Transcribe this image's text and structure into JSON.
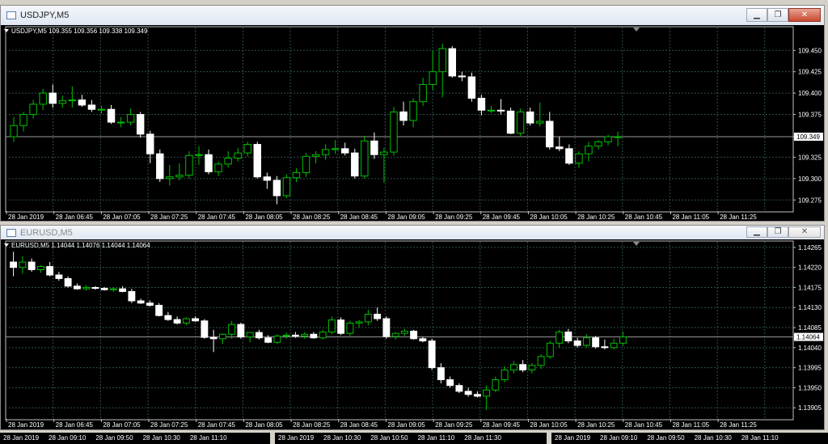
{
  "colors": {
    "bull": "#00c000",
    "bear": "#ffffff",
    "bg": "#000000",
    "grid": "#2f4f4f",
    "text": "#ffffff"
  },
  "window1": {
    "title": "USDJPY,M5",
    "header_text": "USDJPY,M5  109.355 109.356 109.338 109.349",
    "price_label": "109.349",
    "y_ticks": [
      "109.450",
      "109.425",
      "109.400",
      "109.375",
      "109.349",
      "109.325",
      "109.300",
      "109.275"
    ],
    "x_labels": [
      "28 Jan 2019",
      "28 Jan 06:45",
      "28 Jan 07:05",
      "28 Jan 07:25",
      "28 Jan 07:45",
      "28 Jan 08:05",
      "28 Jan 08:25",
      "28 Jan 08:45",
      "28 Jan 09:05",
      "28 Jan 09:25",
      "28 Jan 09:45",
      "28 Jan 10:05",
      "28 Jan 10:25",
      "28 Jan 10:45",
      "28 Jan 11:05",
      "28 Jan 11:25"
    ],
    "buttons": {
      "minimize": "▁",
      "restore": "❐",
      "close": "✕"
    }
  },
  "window2": {
    "title": "EURUSD,M5",
    "header_text": "EURUSD,M5  1.14044 1.14076 1.14044 1.14064",
    "price_label": "1.14064",
    "y_ticks": [
      "1.14265",
      "1.14220",
      "1.14175",
      "1.14130",
      "1.14085",
      "1.14040",
      "1.13995",
      "1.13950",
      "1.13905"
    ],
    "x_labels": [
      "28 Jan 2019",
      "28 Jan 06:45",
      "28 Jan 07:05",
      "28 Jan 07:25",
      "28 Jan 07:45",
      "28 Jan 08:05",
      "28 Jan 08:25",
      "28 Jan 08:45",
      "28 Jan 09:05",
      "28 Jan 09:25",
      "28 Jan 09:45",
      "28 Jan 10:05",
      "28 Jan 10:25",
      "28 Jan 10:45",
      "28 Jan 11:05",
      "28 Jan 11:25"
    ],
    "buttons": {
      "minimize": "▁",
      "restore": "❐",
      "close": "✕"
    }
  },
  "bottom_tabs": [
    {
      "labels": [
        "28 Jan 2019",
        "28 Jan 09:10",
        "28 Jan 09:50",
        "28 Jan 10:30",
        "28 Jan 11:10"
      ]
    },
    {
      "labels": [
        "28 Jan 2019",
        "28 Jan 10:30",
        "28 Jan 10:50",
        "28 Jan 11:10",
        "28 Jan 11:30"
      ]
    },
    {
      "labels": [
        "28 Jan 2019",
        "28 Jan 09:10",
        "28 Jan 09:50",
        "28 Jan 10:30",
        "28 Jan 11:10"
      ]
    }
  ],
  "chart_data": [
    {
      "type": "candlestick",
      "title": "USDJPY,M5",
      "ylim": [
        109.262,
        109.472
      ],
      "candles": [
        {
          "o": 109.349,
          "h": 109.372,
          "l": 109.343,
          "c": 109.362
        },
        {
          "o": 109.362,
          "h": 109.378,
          "l": 109.355,
          "c": 109.375
        },
        {
          "o": 109.375,
          "h": 109.392,
          "l": 109.37,
          "c": 109.387
        },
        {
          "o": 109.387,
          "h": 109.405,
          "l": 109.38,
          "c": 109.4
        },
        {
          "o": 109.4,
          "h": 109.41,
          "l": 109.383,
          "c": 109.388
        },
        {
          "o": 109.388,
          "h": 109.397,
          "l": 109.383,
          "c": 109.391
        },
        {
          "o": 109.391,
          "h": 109.408,
          "l": 109.383,
          "c": 109.392
        },
        {
          "o": 109.392,
          "h": 109.398,
          "l": 109.384,
          "c": 109.386
        },
        {
          "o": 109.386,
          "h": 109.392,
          "l": 109.378,
          "c": 109.381
        },
        {
          "o": 109.381,
          "h": 109.385,
          "l": 109.376,
          "c": 109.381
        },
        {
          "o": 109.381,
          "h": 109.386,
          "l": 109.364,
          "c": 109.366
        },
        {
          "o": 109.366,
          "h": 109.372,
          "l": 109.36,
          "c": 109.366
        },
        {
          "o": 109.366,
          "h": 109.382,
          "l": 109.362,
          "c": 109.375
        },
        {
          "o": 109.375,
          "h": 109.378,
          "l": 109.348,
          "c": 109.352
        },
        {
          "o": 109.352,
          "h": 109.356,
          "l": 109.318,
          "c": 109.329
        },
        {
          "o": 109.329,
          "h": 109.334,
          "l": 109.296,
          "c": 109.3
        },
        {
          "o": 109.3,
          "h": 109.316,
          "l": 109.292,
          "c": 109.302
        },
        {
          "o": 109.302,
          "h": 109.318,
          "l": 109.298,
          "c": 109.304
        },
        {
          "o": 109.304,
          "h": 109.332,
          "l": 109.3,
          "c": 109.327
        },
        {
          "o": 109.327,
          "h": 109.338,
          "l": 109.316,
          "c": 109.328
        },
        {
          "o": 109.328,
          "h": 109.334,
          "l": 109.305,
          "c": 109.308
        },
        {
          "o": 109.308,
          "h": 109.32,
          "l": 109.303,
          "c": 109.317
        },
        {
          "o": 109.317,
          "h": 109.332,
          "l": 109.313,
          "c": 109.324
        },
        {
          "o": 109.324,
          "h": 109.336,
          "l": 109.32,
          "c": 109.33
        },
        {
          "o": 109.33,
          "h": 109.343,
          "l": 109.326,
          "c": 109.34
        },
        {
          "o": 109.34,
          "h": 109.343,
          "l": 109.3,
          "c": 109.302
        },
        {
          "o": 109.302,
          "h": 109.307,
          "l": 109.288,
          "c": 109.298
        },
        {
          "o": 109.298,
          "h": 109.303,
          "l": 109.27,
          "c": 109.28
        },
        {
          "o": 109.28,
          "h": 109.305,
          "l": 109.277,
          "c": 109.301
        },
        {
          "o": 109.301,
          "h": 109.312,
          "l": 109.296,
          "c": 109.307
        },
        {
          "o": 109.307,
          "h": 109.33,
          "l": 109.302,
          "c": 109.326
        },
        {
          "o": 109.326,
          "h": 109.332,
          "l": 109.318,
          "c": 109.328
        },
        {
          "o": 109.328,
          "h": 109.34,
          "l": 109.322,
          "c": 109.334
        },
        {
          "o": 109.334,
          "h": 109.345,
          "l": 109.329,
          "c": 109.335
        },
        {
          "o": 109.335,
          "h": 109.342,
          "l": 109.327,
          "c": 109.33
        },
        {
          "o": 109.33,
          "h": 109.335,
          "l": 109.3,
          "c": 109.303
        },
        {
          "o": 109.303,
          "h": 109.35,
          "l": 109.3,
          "c": 109.344
        },
        {
          "o": 109.344,
          "h": 109.354,
          "l": 109.323,
          "c": 109.328
        },
        {
          "o": 109.328,
          "h": 109.336,
          "l": 109.295,
          "c": 109.331
        },
        {
          "o": 109.331,
          "h": 109.384,
          "l": 109.327,
          "c": 109.378
        },
        {
          "o": 109.378,
          "h": 109.39,
          "l": 109.362,
          "c": 109.368
        },
        {
          "o": 109.368,
          "h": 109.394,
          "l": 109.36,
          "c": 109.39
        },
        {
          "o": 109.39,
          "h": 109.418,
          "l": 109.385,
          "c": 109.41
        },
        {
          "o": 109.41,
          "h": 109.45,
          "l": 109.403,
          "c": 109.425
        },
        {
          "o": 109.425,
          "h": 109.458,
          "l": 109.395,
          "c": 109.452
        },
        {
          "o": 109.452,
          "h": 109.455,
          "l": 109.418,
          "c": 109.42
        },
        {
          "o": 109.42,
          "h": 109.425,
          "l": 109.414,
          "c": 109.419
        },
        {
          "o": 109.419,
          "h": 109.424,
          "l": 109.39,
          "c": 109.394
        },
        {
          "o": 109.394,
          "h": 109.398,
          "l": 109.374,
          "c": 109.38
        },
        {
          "o": 109.38,
          "h": 109.385,
          "l": 109.377,
          "c": 109.38
        },
        {
          "o": 109.38,
          "h": 109.393,
          "l": 109.375,
          "c": 109.379
        },
        {
          "o": 109.379,
          "h": 109.383,
          "l": 109.352,
          "c": 109.353
        },
        {
          "o": 109.353,
          "h": 109.382,
          "l": 109.35,
          "c": 109.378
        },
        {
          "o": 109.378,
          "h": 109.383,
          "l": 109.362,
          "c": 109.365
        },
        {
          "o": 109.365,
          "h": 109.389,
          "l": 109.361,
          "c": 109.367
        },
        {
          "o": 109.367,
          "h": 109.378,
          "l": 109.334,
          "c": 109.337
        },
        {
          "o": 109.337,
          "h": 109.349,
          "l": 109.332,
          "c": 109.335
        },
        {
          "o": 109.335,
          "h": 109.34,
          "l": 109.316,
          "c": 109.318
        },
        {
          "o": 109.318,
          "h": 109.332,
          "l": 109.313,
          "c": 109.329
        },
        {
          "o": 109.329,
          "h": 109.343,
          "l": 109.32,
          "c": 109.338
        },
        {
          "o": 109.338,
          "h": 109.345,
          "l": 109.334,
          "c": 109.343
        },
        {
          "o": 109.343,
          "h": 109.351,
          "l": 109.339,
          "c": 109.349
        },
        {
          "o": 109.349,
          "h": 109.355,
          "l": 109.338,
          "c": 109.349
        }
      ]
    },
    {
      "type": "candlestick",
      "title": "EURUSD,M5",
      "ylim": [
        1.1388,
        1.14272
      ],
      "candles": [
        {
          "o": 1.14232,
          "h": 1.14255,
          "l": 1.142,
          "c": 1.1422
        },
        {
          "o": 1.1422,
          "h": 1.14245,
          "l": 1.14206,
          "c": 1.14232
        },
        {
          "o": 1.14232,
          "h": 1.1424,
          "l": 1.1421,
          "c": 1.14215
        },
        {
          "o": 1.14215,
          "h": 1.14225,
          "l": 1.14208,
          "c": 1.14222
        },
        {
          "o": 1.14222,
          "h": 1.14232,
          "l": 1.142,
          "c": 1.14203
        },
        {
          "o": 1.14203,
          "h": 1.1421,
          "l": 1.1419,
          "c": 1.14195
        },
        {
          "o": 1.14195,
          "h": 1.142,
          "l": 1.14175,
          "c": 1.14178
        },
        {
          "o": 1.14178,
          "h": 1.14184,
          "l": 1.1417,
          "c": 1.14172
        },
        {
          "o": 1.14172,
          "h": 1.1418,
          "l": 1.14168,
          "c": 1.14175
        },
        {
          "o": 1.14175,
          "h": 1.14178,
          "l": 1.1417,
          "c": 1.14173
        },
        {
          "o": 1.14173,
          "h": 1.14176,
          "l": 1.14168,
          "c": 1.1417
        },
        {
          "o": 1.1417,
          "h": 1.14176,
          "l": 1.14165,
          "c": 1.14172
        },
        {
          "o": 1.14172,
          "h": 1.14178,
          "l": 1.14164,
          "c": 1.14166
        },
        {
          "o": 1.14166,
          "h": 1.14172,
          "l": 1.1414,
          "c": 1.14145
        },
        {
          "o": 1.14145,
          "h": 1.1415,
          "l": 1.14138,
          "c": 1.1414
        },
        {
          "o": 1.1414,
          "h": 1.14146,
          "l": 1.14132,
          "c": 1.14135
        },
        {
          "o": 1.14135,
          "h": 1.1414,
          "l": 1.1411,
          "c": 1.14112
        },
        {
          "o": 1.14112,
          "h": 1.1412,
          "l": 1.141,
          "c": 1.14103
        },
        {
          "o": 1.14103,
          "h": 1.1411,
          "l": 1.14092,
          "c": 1.14095
        },
        {
          "o": 1.14095,
          "h": 1.14108,
          "l": 1.1409,
          "c": 1.14105
        },
        {
          "o": 1.14105,
          "h": 1.1411,
          "l": 1.14098,
          "c": 1.141
        },
        {
          "o": 1.141,
          "h": 1.14104,
          "l": 1.1406,
          "c": 1.14063
        },
        {
          "o": 1.14063,
          "h": 1.1408,
          "l": 1.1403,
          "c": 1.1406
        },
        {
          "o": 1.1406,
          "h": 1.14072,
          "l": 1.14048,
          "c": 1.1407
        },
        {
          "o": 1.1407,
          "h": 1.141,
          "l": 1.1406,
          "c": 1.14092
        },
        {
          "o": 1.14092,
          "h": 1.14096,
          "l": 1.1406,
          "c": 1.14064
        },
        {
          "o": 1.14064,
          "h": 1.14075,
          "l": 1.14052,
          "c": 1.14074
        },
        {
          "o": 1.14074,
          "h": 1.1408,
          "l": 1.14058,
          "c": 1.14062
        },
        {
          "o": 1.14062,
          "h": 1.14068,
          "l": 1.1405,
          "c": 1.14052
        },
        {
          "o": 1.14052,
          "h": 1.1407,
          "l": 1.14048,
          "c": 1.14066
        },
        {
          "o": 1.14066,
          "h": 1.14074,
          "l": 1.1406,
          "c": 1.14068
        },
        {
          "o": 1.14068,
          "h": 1.14075,
          "l": 1.14062,
          "c": 1.14066
        },
        {
          "o": 1.14066,
          "h": 1.14074,
          "l": 1.1406,
          "c": 1.1407
        },
        {
          "o": 1.1407,
          "h": 1.14075,
          "l": 1.1406,
          "c": 1.14062
        },
        {
          "o": 1.14062,
          "h": 1.1408,
          "l": 1.14058,
          "c": 1.14075
        },
        {
          "o": 1.14075,
          "h": 1.1411,
          "l": 1.1407,
          "c": 1.14102
        },
        {
          "o": 1.14102,
          "h": 1.14108,
          "l": 1.14068,
          "c": 1.14072
        },
        {
          "o": 1.14072,
          "h": 1.141,
          "l": 1.14066,
          "c": 1.14095
        },
        {
          "o": 1.14095,
          "h": 1.14102,
          "l": 1.14085,
          "c": 1.14098
        },
        {
          "o": 1.14098,
          "h": 1.14125,
          "l": 1.1409,
          "c": 1.14115
        },
        {
          "o": 1.14115,
          "h": 1.1413,
          "l": 1.141,
          "c": 1.14105
        },
        {
          "o": 1.14105,
          "h": 1.1411,
          "l": 1.1406,
          "c": 1.14065
        },
        {
          "o": 1.14065,
          "h": 1.14075,
          "l": 1.14058,
          "c": 1.14072
        },
        {
          "o": 1.14072,
          "h": 1.14082,
          "l": 1.14066,
          "c": 1.14077
        },
        {
          "o": 1.14077,
          "h": 1.1408,
          "l": 1.14058,
          "c": 1.1406
        },
        {
          "o": 1.1406,
          "h": 1.14064,
          "l": 1.14052,
          "c": 1.14055
        },
        {
          "o": 1.14055,
          "h": 1.1406,
          "l": 1.1399,
          "c": 1.13995
        },
        {
          "o": 1.13995,
          "h": 1.14005,
          "l": 1.1396,
          "c": 1.13968
        },
        {
          "o": 1.13968,
          "h": 1.13975,
          "l": 1.1395,
          "c": 1.13955
        },
        {
          "o": 1.13955,
          "h": 1.1396,
          "l": 1.13938,
          "c": 1.13942
        },
        {
          "o": 1.13942,
          "h": 1.1395,
          "l": 1.1393,
          "c": 1.13935
        },
        {
          "o": 1.13935,
          "h": 1.13942,
          "l": 1.13928,
          "c": 1.13931
        },
        {
          "o": 1.13931,
          "h": 1.13955,
          "l": 1.139,
          "c": 1.13945
        },
        {
          "o": 1.13945,
          "h": 1.13975,
          "l": 1.1394,
          "c": 1.13968
        },
        {
          "o": 1.13968,
          "h": 1.13998,
          "l": 1.13962,
          "c": 1.1399
        },
        {
          "o": 1.1399,
          "h": 1.1401,
          "l": 1.13982,
          "c": 1.14002
        },
        {
          "o": 1.14002,
          "h": 1.14012,
          "l": 1.13985,
          "c": 1.1399
        },
        {
          "o": 1.1399,
          "h": 1.14005,
          "l": 1.13982,
          "c": 1.14
        },
        {
          "o": 1.14,
          "h": 1.14025,
          "l": 1.13992,
          "c": 1.1402
        },
        {
          "o": 1.1402,
          "h": 1.14055,
          "l": 1.14015,
          "c": 1.1405
        },
        {
          "o": 1.1405,
          "h": 1.1408,
          "l": 1.1404,
          "c": 1.14075
        },
        {
          "o": 1.14075,
          "h": 1.14082,
          "l": 1.1405,
          "c": 1.14055
        },
        {
          "o": 1.14055,
          "h": 1.14062,
          "l": 1.1404,
          "c": 1.14045
        },
        {
          "o": 1.14045,
          "h": 1.1407,
          "l": 1.1404,
          "c": 1.14062
        },
        {
          "o": 1.14062,
          "h": 1.14066,
          "l": 1.14038,
          "c": 1.14042
        },
        {
          "o": 1.14042,
          "h": 1.14058,
          "l": 1.14036,
          "c": 1.1404
        },
        {
          "o": 1.1404,
          "h": 1.1406,
          "l": 1.14036,
          "c": 1.1405
        },
        {
          "o": 1.1405,
          "h": 1.14076,
          "l": 1.14044,
          "c": 1.14064
        }
      ]
    }
  ]
}
